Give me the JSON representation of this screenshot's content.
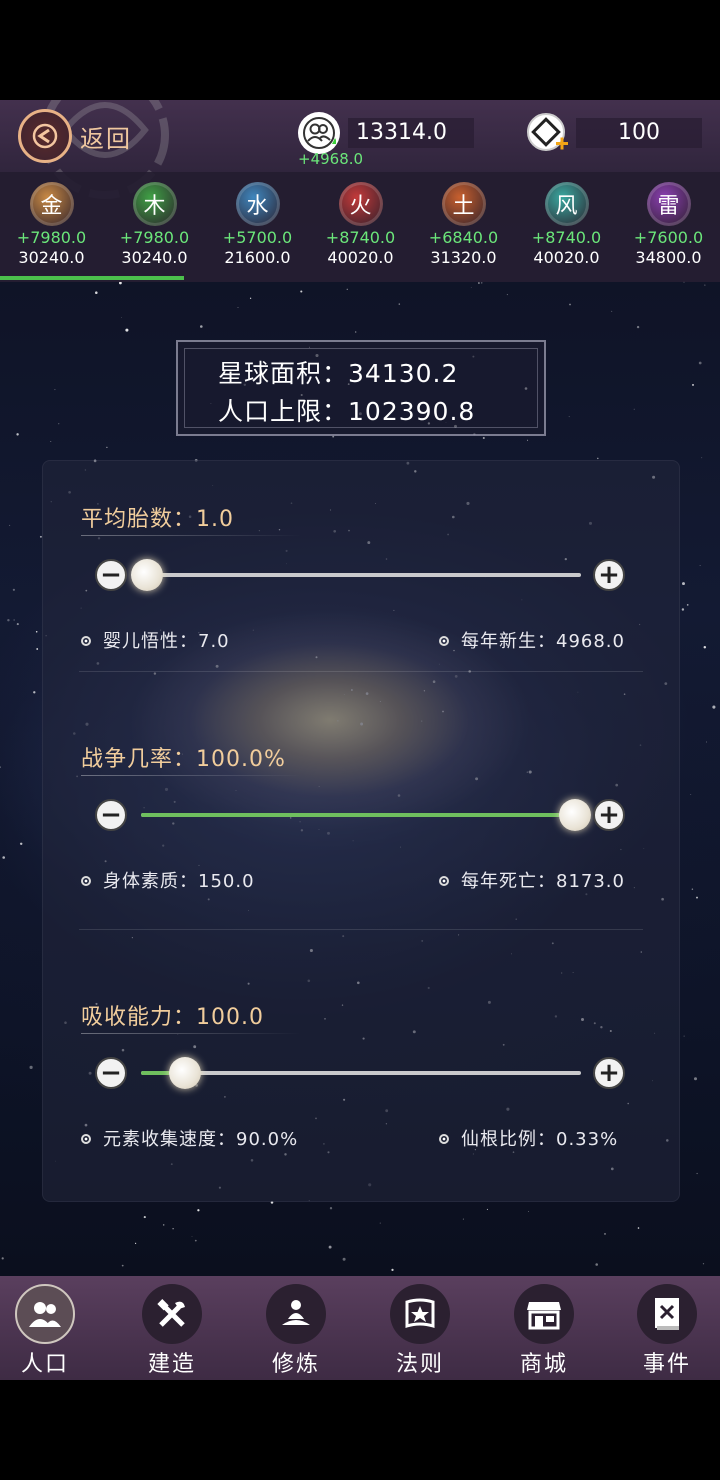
{
  "header": {
    "back_label": "返回",
    "population": {
      "value": "13314.0",
      "delta": "+4968.0",
      "icon": "people-icon"
    },
    "gems": {
      "value": "100",
      "icon": "gem-plus-icon"
    }
  },
  "elements": [
    {
      "name": "金",
      "rate": "+7980.0",
      "total": "30240.0",
      "color": "#c98a45"
    },
    {
      "name": "木",
      "rate": "+7980.0",
      "total": "30240.0",
      "color": "#3fa045"
    },
    {
      "name": "水",
      "rate": "+5700.0",
      "total": "21600.0",
      "color": "#3f86bd"
    },
    {
      "name": "火",
      "rate": "+8740.0",
      "total": "40020.0",
      "color": "#c33a3a"
    },
    {
      "name": "土",
      "rate": "+6840.0",
      "total": "31320.0",
      "color": "#c8602e"
    },
    {
      "name": "风",
      "rate": "+8740.0",
      "total": "40020.0",
      "color": "#3aa8a0"
    },
    {
      "name": "雷",
      "rate": "+7600.0",
      "total": "34800.0",
      "color": "#8a3fb0"
    }
  ],
  "planet": {
    "area_label": "星球面积：",
    "area_value": "34130.2",
    "limit_label": "人口上限：",
    "limit_value": "102390.8"
  },
  "sections": [
    {
      "title": "平均胎数：1.0",
      "slider_fraction": 0.0,
      "stat_left": "婴儿悟性：7.0",
      "stat_right": "每年新生：4968.0"
    },
    {
      "title": "战争几率：100.0%",
      "slider_fraction": 1.0,
      "stat_left": "身体素质：150.0",
      "stat_right": "每年死亡：8173.0"
    },
    {
      "title": "吸收能力：100.0",
      "slider_fraction": 0.1,
      "stat_left": "元素收集速度：90.0%",
      "stat_right": "仙根比例：0.33%"
    }
  ],
  "nav": [
    {
      "label": "人口",
      "icon": "people-icon",
      "active": true
    },
    {
      "label": "建造",
      "icon": "tools-icon",
      "active": false
    },
    {
      "label": "修炼",
      "icon": "meditate-icon",
      "active": false
    },
    {
      "label": "法则",
      "icon": "rule-banner-icon",
      "active": false
    },
    {
      "label": "商城",
      "icon": "shop-icon",
      "active": false
    },
    {
      "label": "事件",
      "icon": "book-icon",
      "active": false
    }
  ]
}
